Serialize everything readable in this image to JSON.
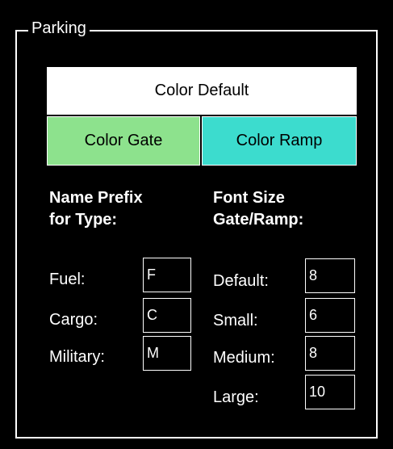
{
  "group": {
    "title": "Parking"
  },
  "buttons": {
    "color_default": "Color Default",
    "color_gate": "Color Gate",
    "color_ramp": "Color Ramp"
  },
  "colors": {
    "default": "#ffffff",
    "gate": "#8de28d",
    "ramp": "#3cdcce"
  },
  "name_prefix": {
    "heading_line1": "Name Prefix",
    "heading_line2": "for Type:",
    "rows": [
      {
        "label": "Fuel:",
        "value": "F"
      },
      {
        "label": "Cargo:",
        "value": "C"
      },
      {
        "label": "Military:",
        "value": "M"
      }
    ]
  },
  "font_size": {
    "heading_line1": "Font Size",
    "heading_line2": "Gate/Ramp:",
    "rows": [
      {
        "label": "Default:",
        "value": "8"
      },
      {
        "label": "Small:",
        "value": "6"
      },
      {
        "label": "Medium:",
        "value": "8"
      },
      {
        "label": "Large:",
        "value": "10"
      }
    ]
  }
}
